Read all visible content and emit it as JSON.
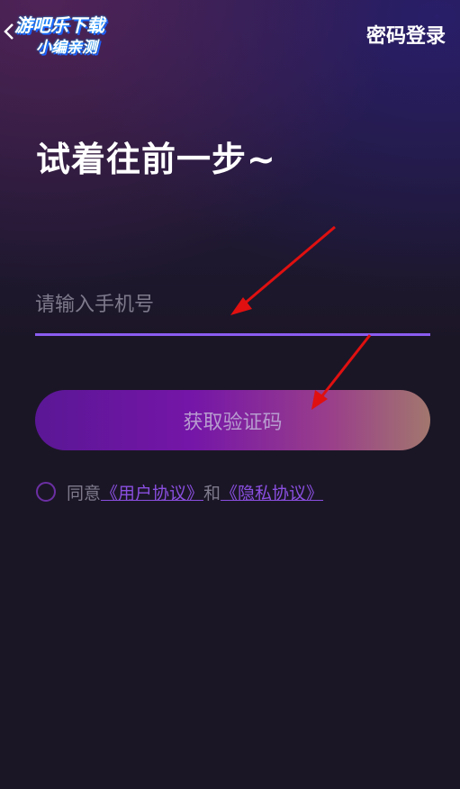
{
  "watermark": {
    "line1": "游吧乐下载",
    "line2": "小编亲测"
  },
  "header": {
    "password_login": "密码登录"
  },
  "main": {
    "headline": "试着往前一步~",
    "phone_placeholder": "请输入手机号",
    "get_code_label": "获取验证码"
  },
  "agreement": {
    "prefix": "同意",
    "user_agreement": "《用户协议》",
    "connector": "和",
    "privacy_agreement": "《隐私协议》"
  },
  "colors": {
    "accent_underline": "#8a5cf0",
    "link": "#8a4fe0",
    "annotation_arrow": "#e01010"
  }
}
